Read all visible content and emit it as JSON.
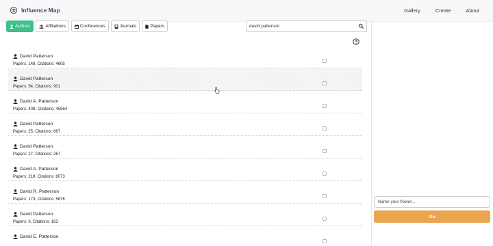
{
  "navbar": {
    "brand": "Influence Map",
    "links": [
      "Gallery",
      "Create",
      "About"
    ]
  },
  "tabs": [
    {
      "label": "Authors",
      "icon": "person-icon",
      "active": true
    },
    {
      "label": "Affiliations",
      "icon": "institution-icon",
      "active": false
    },
    {
      "label": "Conferences",
      "icon": "calendar-icon",
      "active": false
    },
    {
      "label": "Journals",
      "icon": "book-icon",
      "active": false
    },
    {
      "label": "Papers",
      "icon": "file-icon",
      "active": false
    }
  ],
  "search": {
    "value": "david patterson",
    "icon": "search-icon"
  },
  "results": [
    {
      "name": "David Patterson",
      "stats": "Papers: 148, Citations: 4605",
      "checked": false
    },
    {
      "name": "David Patterson",
      "stats": "Papers: 54, Citations: 901",
      "checked": false
    },
    {
      "name": "David A. Patterson",
      "stats": "Papers: 408, Citations: 45964",
      "checked": false
    },
    {
      "name": "David Patterson",
      "stats": "Papers: 25, Citations: 667",
      "checked": false
    },
    {
      "name": "David Patterson",
      "stats": "Papers: 27, Citations: 267",
      "checked": false
    },
    {
      "name": "David A. Patterson",
      "stats": "Papers: 219, Citations: 8073",
      "checked": false
    },
    {
      "name": "David R. Patterson",
      "stats": "Papers: 173, Citations: 5876",
      "checked": false
    },
    {
      "name": "David Patterson",
      "stats": "Papers: 6, Citations: 163",
      "checked": false
    },
    {
      "name": "David E. Patterson",
      "stats": "",
      "checked": false
    }
  ],
  "sidebar": {
    "flower_placeholder": "Name your flower...",
    "go_label": "Go"
  },
  "colors": {
    "accent": "#3fbf8a",
    "go_button": "#eaa54f",
    "brand_text": "#3b4b6b"
  }
}
